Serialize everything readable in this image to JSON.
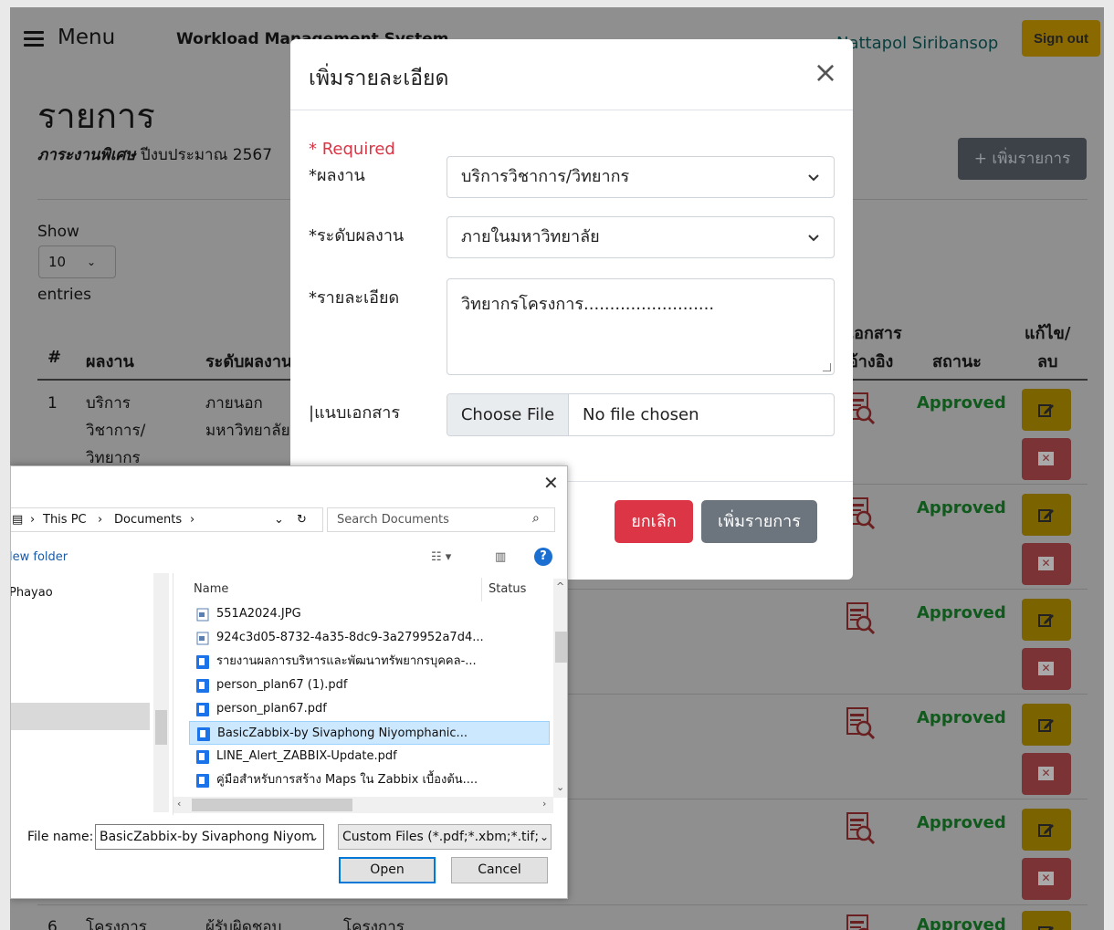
{
  "header": {
    "menu_label": "Menu",
    "brand": "Workload Management System",
    "user_name": "Nattapol Siribansop",
    "signout_label": "Sign out"
  },
  "page": {
    "heading": "รายการ",
    "subtitle_bold": "ภาระงานพิเศษ",
    "subtitle_rest": " ปีงบประมาณ 2567",
    "add_button": "+ เพิ่มรายการ",
    "show_label": "Show",
    "entries_value": "10",
    "entries_label": "entries"
  },
  "table": {
    "headers": {
      "num": "#",
      "result": "ผลงาน",
      "level": "ระดับผลงาน",
      "doc_line1": "เอกสาร",
      "doc_line2": "อ้างอิง",
      "status": "สถานะ",
      "edit_line1": "แก้ไข/",
      "edit_line2": "ลบ"
    },
    "rows": [
      {
        "num": "1",
        "result_l1": "บริการ",
        "result_l2": "วิชาการ/",
        "result_l3": "วิทยากร",
        "level_l1": "ภายนอก",
        "level_l2": "มหาวิทยาลัย",
        "status": "Approved"
      },
      {
        "status": "Approved"
      },
      {
        "status": "Approved"
      },
      {
        "status": "Approved"
      },
      {
        "status": "Approved"
      },
      {
        "num": "6",
        "result_l1": "โครงการ",
        "level_l1": "ผู้รับผิดชอบ",
        "detail_l1": "โครงการ",
        "status": "Approved"
      }
    ]
  },
  "modal": {
    "title": "เพิ่มรายละเอียด",
    "required_note": "* Required",
    "field_result_label": "*ผลงาน",
    "field_result_value": "บริการวิชาการ/วิทยากร",
    "field_level_label": "*ระดับผลงาน",
    "field_level_value": "ภายในมหาวิทยาลัย",
    "field_detail_label": "*รายละเอียด",
    "field_detail_value": "วิทยากรโครงการ.........................",
    "field_attach_label": "|แนบเอกสาร",
    "choose_file": "Choose File",
    "no_file": "No file chosen",
    "cancel_button": "ยกเลิก",
    "add_button": "เพิ่มรายการ"
  },
  "file_dialog": {
    "crumb_this_pc": "This PC",
    "crumb_documents": "Documents",
    "search_placeholder": "Search Documents",
    "new_folder": "lew folder",
    "nav_item": "Phayao",
    "col_name": "Name",
    "col_status": "Status",
    "files": [
      "551A2024.JPG",
      "924c3d05-8732-4a35-8dc9-3a279952a7d4...",
      "รายงานผลการบริหารและพัฒนาทรัพยากรบุคคล-...",
      "person_plan67 (1).pdf",
      "person_plan67.pdf",
      "BasicZabbix-by Sivaphong Niyomphanic...",
      "LINE_Alert_ZABBIX-Update.pdf",
      "คู่มือสำหรับการสร้าง Maps ใน Zabbix เบื้องต้น...."
    ],
    "file_name_label": "File name:",
    "file_name_value": "BasicZabbix-by Sivaphong Niyom",
    "filter_value": "Custom Files (*.pdf;*.xbm;*.tif;*",
    "open_button": "Open",
    "cancel_button": "Cancel"
  },
  "colors": {
    "overlay": "#8f8f8f",
    "danger": "#dc3545",
    "secondary": "#6c757d",
    "approved": "#0f5a1c",
    "selection": "#cce8ff"
  }
}
